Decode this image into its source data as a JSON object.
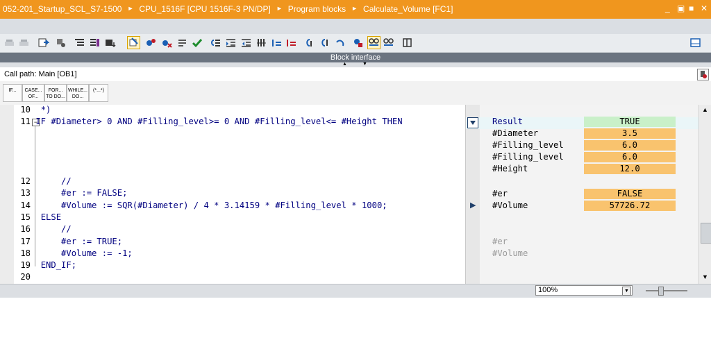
{
  "titlebar": {
    "crumbs": [
      "052-201_Startup_SCL_S7-1500",
      "CPU_1516F [CPU 1516F-3 PN/DP]",
      "Program blocks",
      "Calculate_Volume [FC1]"
    ],
    "controls": [
      "_",
      "▣",
      "■",
      "✕"
    ],
    "bg": "#f0961e"
  },
  "block_interface": {
    "label": "Block interface"
  },
  "callpath": {
    "label": "Call path: Main [OB1]"
  },
  "snippets": [
    {
      "label": "IF..."
    },
    {
      "label": "CASE... OF..."
    },
    {
      "label": "FOR... TO DO..."
    },
    {
      "label": "WHILE... DO..."
    },
    {
      "label": "(*...*)"
    }
  ],
  "code_lines": [
    {
      "num": "10",
      "text": "*)"
    },
    {
      "num": "11",
      "text": "IF #Diameter> 0 AND #Filling_level>= 0 AND #Filling_level<= #Height THEN"
    },
    {
      "num": "12",
      "text": "    //"
    },
    {
      "num": "13",
      "text": "    #er := FALSE;"
    },
    {
      "num": "14",
      "text": "    #Volume := SQR(#Diameter) / 4 * 3.14159 * #Filling_level * 1000;"
    },
    {
      "num": "15",
      "text": "ELSE"
    },
    {
      "num": "16",
      "text": "    //"
    },
    {
      "num": "17",
      "text": "    #er := TRUE;"
    },
    {
      "num": "18",
      "text": "    #Volume := -1;"
    },
    {
      "num": "19",
      "text": "END_IF;"
    },
    {
      "num": "20",
      "text": ""
    }
  ],
  "monitor": {
    "rows": [
      {
        "name": "Result",
        "value": "TRUE"
      },
      {
        "name": "#Diameter",
        "value": "3.5"
      },
      {
        "name": "#Filling_level",
        "value": "6.0"
      },
      {
        "name": "#Filling_level",
        "value": "6.0"
      },
      {
        "name": "#Height",
        "value": "12.0"
      },
      {
        "name": "#er",
        "value": "FALSE"
      },
      {
        "name": "#Volume",
        "value": "57726.72"
      },
      {
        "name": "#er",
        "value": ""
      },
      {
        "name": "#Volume",
        "value": ""
      }
    ],
    "colors": {
      "true": "#c9f0c9",
      "value": "#f9c36e",
      "inactive": "#9a9a9a"
    }
  },
  "zoom": {
    "value": "100%"
  }
}
